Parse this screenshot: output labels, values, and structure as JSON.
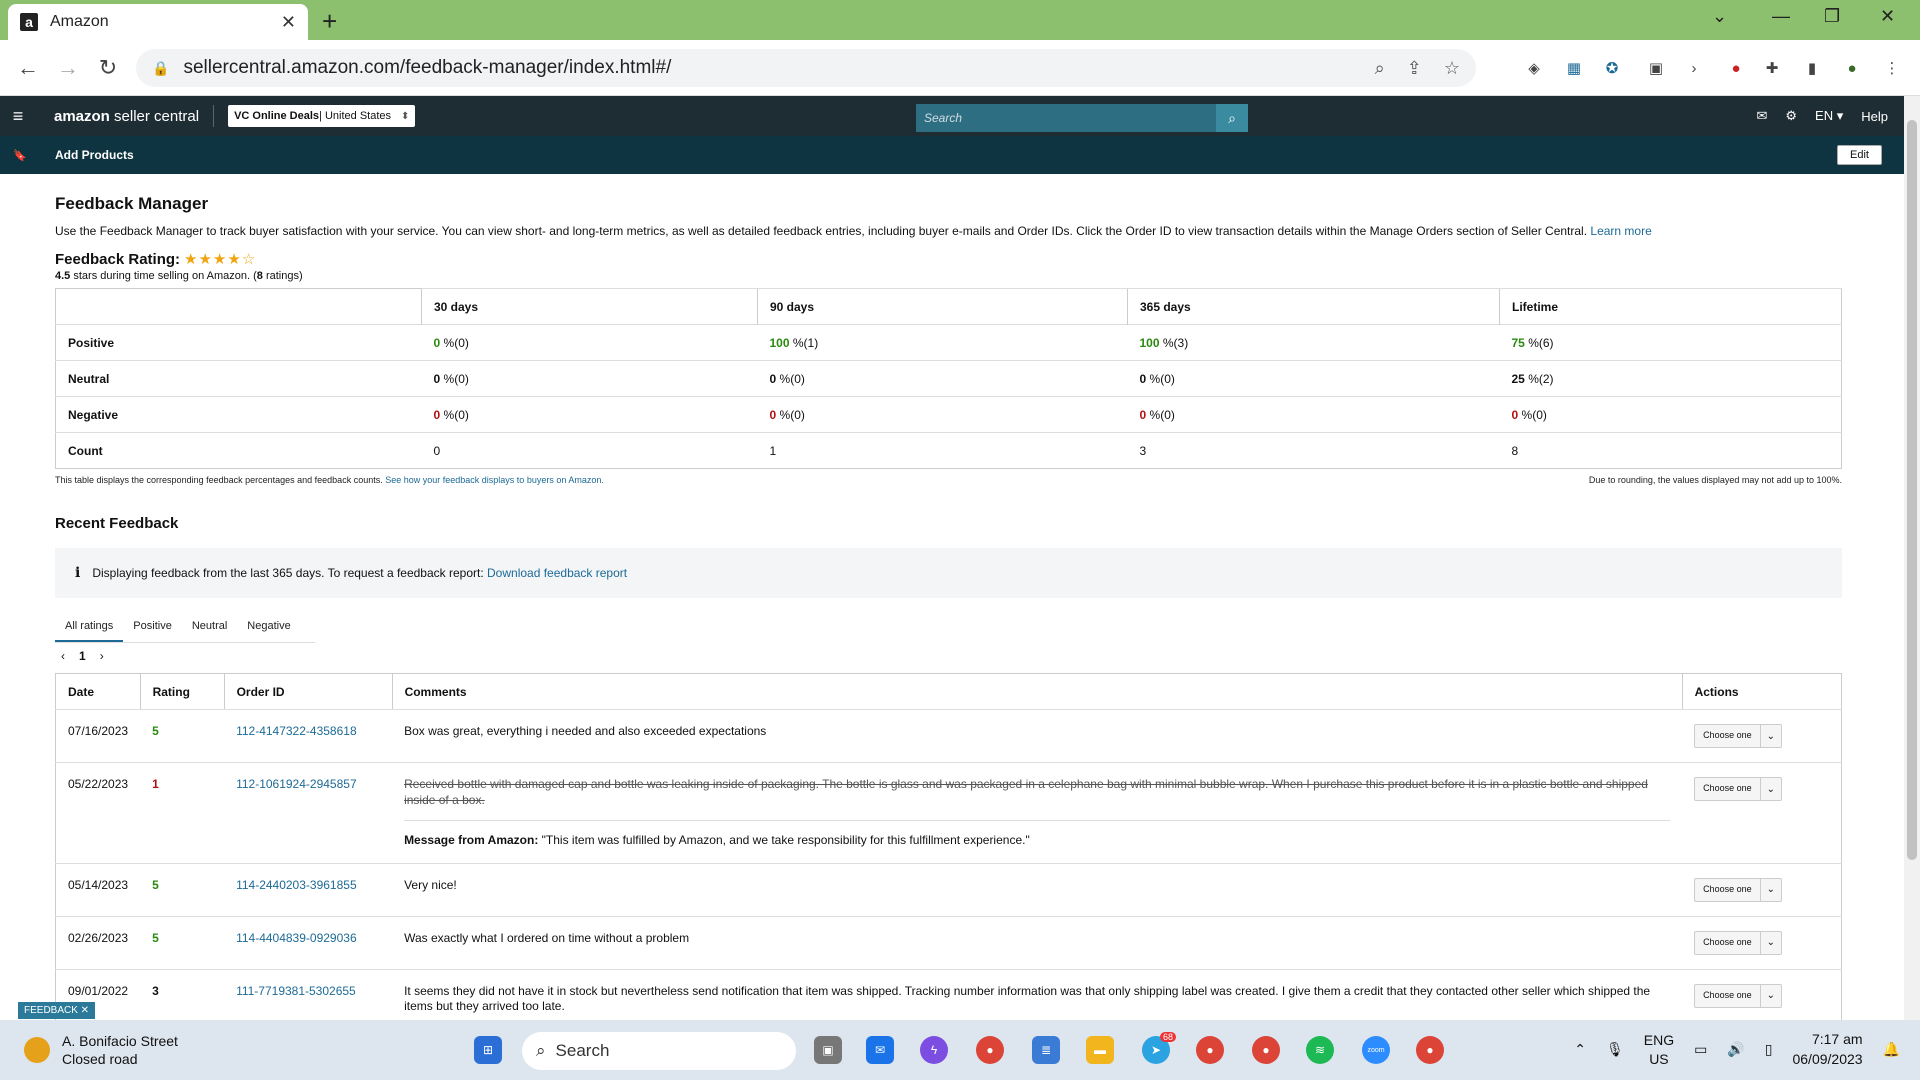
{
  "browser": {
    "tab_title": "Amazon",
    "favicon": "a",
    "url": "sellercentral.amazon.com/feedback-manager/index.html#/"
  },
  "header": {
    "brand_bold": "amazon",
    "brand_rest": " seller central",
    "store_bold": "VC Online Deals",
    "store_rest": " | United States",
    "search_placeholder": "Search",
    "lang": "EN",
    "help": "Help"
  },
  "subnav": {
    "add_products": "Add Products",
    "edit": "Edit"
  },
  "page": {
    "title": "Feedback Manager",
    "description": "Use the Feedback Manager to track buyer satisfaction with your service. You can view short- and long-term metrics, as well as detailed feedback entries, including buyer e-mails and Order IDs. Click the Order ID to view transaction details within the Manage Orders section of Seller Central.",
    "learn_more": "Learn more",
    "rating_label": "Feedback Rating:",
    "stars": "★★★★☆",
    "rating_value": "4.5",
    "rating_text": " stars during time selling on Amazon. (",
    "rating_count": "8",
    "rating_suffix": " ratings)"
  },
  "metrics": {
    "headers": [
      "30 days",
      "90 days",
      "365 days",
      "Lifetime"
    ],
    "rows": [
      {
        "label": "Positive",
        "cells": [
          [
            "0",
            " %(0)"
          ],
          [
            "100",
            " %(1)"
          ],
          [
            "100",
            " %(3)"
          ],
          [
            "75",
            " %(6)"
          ]
        ]
      },
      {
        "label": "Neutral",
        "cells": [
          [
            "0",
            " %(0)"
          ],
          [
            "0",
            " %(0)"
          ],
          [
            "0",
            " %(0)"
          ],
          [
            "25",
            " %(2)"
          ]
        ]
      },
      {
        "label": "Negative",
        "cells": [
          [
            "0",
            " %(0)"
          ],
          [
            "0",
            " %(0)"
          ],
          [
            "0",
            " %(0)"
          ],
          [
            "0",
            " %(0)"
          ]
        ]
      },
      {
        "label": "Count",
        "cells": [
          [
            "",
            "0"
          ],
          [
            "",
            "1"
          ],
          [
            "",
            "3"
          ],
          [
            "",
            "8"
          ]
        ]
      }
    ],
    "note_left": "This table displays the corresponding feedback percentages and feedback counts.",
    "note_link": "See how your feedback displays to buyers on Amazon.",
    "note_right": "Due to rounding, the values displayed may not add up to 100%."
  },
  "recent": {
    "title": "Recent Feedback",
    "info_text": "Displaying feedback from the last 365 days. To request a feedback report:",
    "info_link": "Download feedback report",
    "tabs": [
      "All ratings",
      "Positive",
      "Neutral",
      "Negative"
    ],
    "page": "1",
    "columns": [
      "Date",
      "Rating",
      "Order ID",
      "Comments",
      "Actions"
    ],
    "action_label": "Choose one",
    "rows": [
      {
        "date": "07/16/2023",
        "rating": "5",
        "order": "112-4147322-4358618",
        "comment": "Box was great, everything i needed and also exceeded expectations"
      },
      {
        "date": "05/22/2023",
        "rating": "1",
        "order": "112-1061924-2945857",
        "comment": "Received bottle with damaged cap and bottle was leaking inside of packaging. The bottle is glass and was packaged in a celephane bag with minimal bubble wrap. When I purchase this product before it is in a plastic bottle and shipped inside of a box.",
        "amazon_label": "Message from Amazon:",
        "amazon_msg": " \"This item was fulfilled by Amazon, and we take responsibility for this fulfillment experience.\""
      },
      {
        "date": "05/14/2023",
        "rating": "5",
        "order": "114-2440203-3961855",
        "comment": "Very nice!"
      },
      {
        "date": "02/26/2023",
        "rating": "5",
        "order": "114-4404839-0929036",
        "comment": "Was exactly what I ordered on time without a problem"
      },
      {
        "date": "09/01/2022",
        "rating": "3",
        "order": "111-7719381-5302655",
        "comment": "It seems they did not have it in stock but nevertheless send notification that item was shipped. Tracking number information was that only shipping label was created. I give them a credit that they contacted other seller which shipped the items but they arrived too late."
      }
    ]
  },
  "feedback_tab": "FEEDBACK ✕",
  "taskbar": {
    "weather_title": "A. Bonifacio Street",
    "weather_sub": "Closed road",
    "search": "Search",
    "lang1": "ENG",
    "lang2": "US",
    "time": "7:17 am",
    "date": "06/09/2023",
    "telegram_badge": "68"
  },
  "colors": {
    "chrome_green": "#8cbf6e",
    "header_dark": "#1e2d33",
    "subnav": "#0d3440",
    "link": "#1d6a96",
    "positive": "#2a8a0e",
    "negative": "#b01010",
    "star": "#f0a40f"
  }
}
